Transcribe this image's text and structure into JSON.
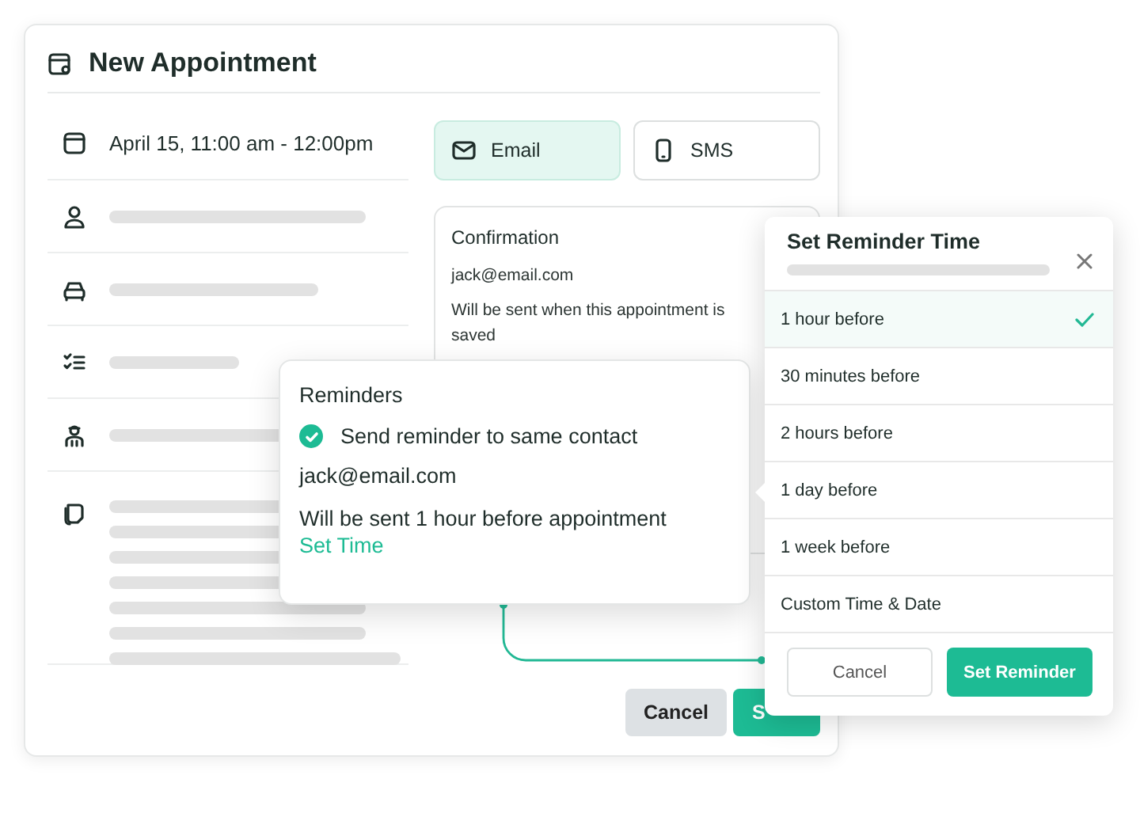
{
  "window": {
    "title": "New Appointment"
  },
  "appointment": {
    "date": "April 15, 11:00 am -  12:00pm"
  },
  "channels": [
    {
      "label": "Email",
      "selected": true
    },
    {
      "label": "SMS",
      "selected": false
    }
  ],
  "confirmation": {
    "title": "Confirmation",
    "contact": "jack@email.com",
    "note": "Will be sent when this appointment is saved"
  },
  "reminders": {
    "title": "Reminders",
    "option": {
      "label": "Send reminder to same contact",
      "checked": true
    },
    "contact": "jack@email.com",
    "note": "Will be sent 1 hour before appointment",
    "link": "Set Time"
  },
  "footer_buttons": [
    {
      "label": "Cancel",
      "kind": "secondary"
    },
    {
      "label": "S",
      "kind": "primary"
    }
  ],
  "reminder_time": {
    "title": "Set Reminder Time",
    "options": [
      {
        "label": "1 hour before",
        "selected": true
      },
      {
        "label": "30 minutes before",
        "selected": false
      },
      {
        "label": "2 hours before",
        "selected": false
      },
      {
        "label": "1 day before",
        "selected": false
      },
      {
        "label": "1 week before",
        "selected": false
      },
      {
        "label": "Custom Time & Date",
        "selected": false
      }
    ],
    "buttons": [
      {
        "label": "Cancel",
        "kind": "secondary"
      },
      {
        "label": "Set Reminder",
        "kind": "primary"
      }
    ]
  }
}
